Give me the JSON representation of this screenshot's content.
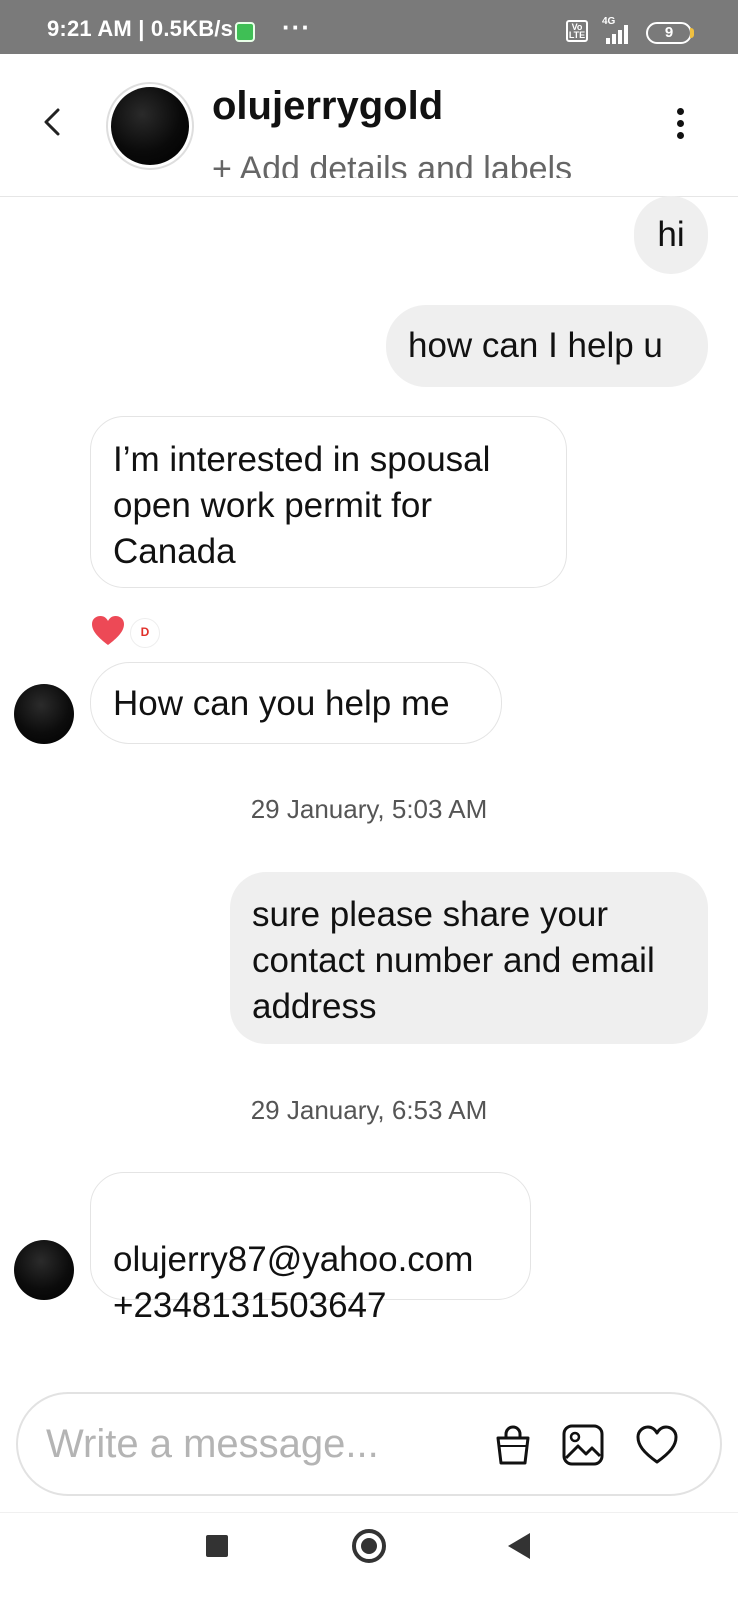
{
  "status_bar": {
    "time": "9:21 AM | 0.5KB/s",
    "more": "···",
    "volte": "Vo LTE",
    "network": "4G",
    "battery": "9"
  },
  "header": {
    "username": "olujerrygold",
    "subtitle": "+ Add details and labels"
  },
  "messages": [
    {
      "direction": "outgoing",
      "text": "hi"
    },
    {
      "direction": "outgoing",
      "text": "how can I help u"
    },
    {
      "direction": "incoming",
      "text": "I’m interested in spousal open work permit for Canada",
      "reactions": [
        "heart-icon",
        "sticker-badge"
      ]
    },
    {
      "direction": "incoming",
      "text": "How can you help me"
    },
    {
      "type": "timestamp",
      "text": "29 January, 5:03 AM"
    },
    {
      "direction": "outgoing",
      "text": "sure please share your contact number and email address"
    },
    {
      "type": "timestamp",
      "text": "29 January, 6:53 AM"
    },
    {
      "direction": "incoming",
      "text": "olujerry87@yahoo.com\n+2348131503647"
    }
  ],
  "composer": {
    "placeholder": "Write a message...",
    "icons": [
      "shopping-bag-icon",
      "gallery-icon",
      "heart-icon"
    ]
  },
  "colors": {
    "outgoing_bubble": "#efefef",
    "incoming_border": "#e4e4e4",
    "heart_reaction": "#ed4956",
    "status_bar": "#7a7a7a"
  }
}
